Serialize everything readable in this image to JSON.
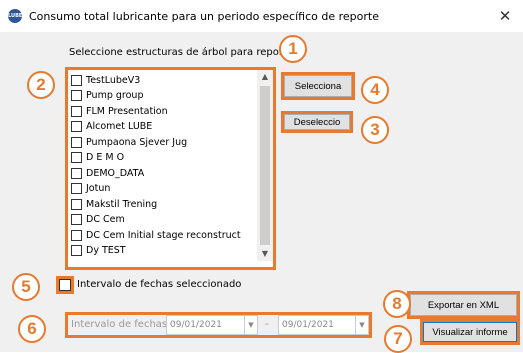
{
  "window": {
    "title": "Consumo total lubricante para un periodo específico de reporte",
    "close": "✕",
    "icon_text": "LUBE"
  },
  "tree_section": {
    "label": "Seleccione estructuras de árbol para reporte",
    "items": [
      {
        "label": "TestLubeV3"
      },
      {
        "label": "Pump group"
      },
      {
        "label": "FLM Presentation"
      },
      {
        "label": "Alcomet LUBE"
      },
      {
        "label": "Pumpaona Sjever Jug"
      },
      {
        "label": "D E M O"
      },
      {
        "label": "DEMO_DATA"
      },
      {
        "label": "Jotun"
      },
      {
        "label": "Makstil Trening"
      },
      {
        "label": "DC Cem"
      },
      {
        "label": "DC Cem Initial stage reconstruct"
      },
      {
        "label": "Dy TEST"
      }
    ]
  },
  "buttons": {
    "select": "Selecciona",
    "deselect": "Deseleccio",
    "export": "Exportar en XML",
    "view": "Visualizar informe"
  },
  "date_range": {
    "checkbox_label": "Intervalo de fechas seleccionado",
    "field_label": "Intervalo de fechas",
    "from": "09/01/2021",
    "separator": "-",
    "to": "09/01/2021"
  },
  "badges": [
    "1",
    "2",
    "3",
    "4",
    "5",
    "6",
    "7",
    "8"
  ],
  "colors": {
    "annotation": "#e77a2e"
  }
}
